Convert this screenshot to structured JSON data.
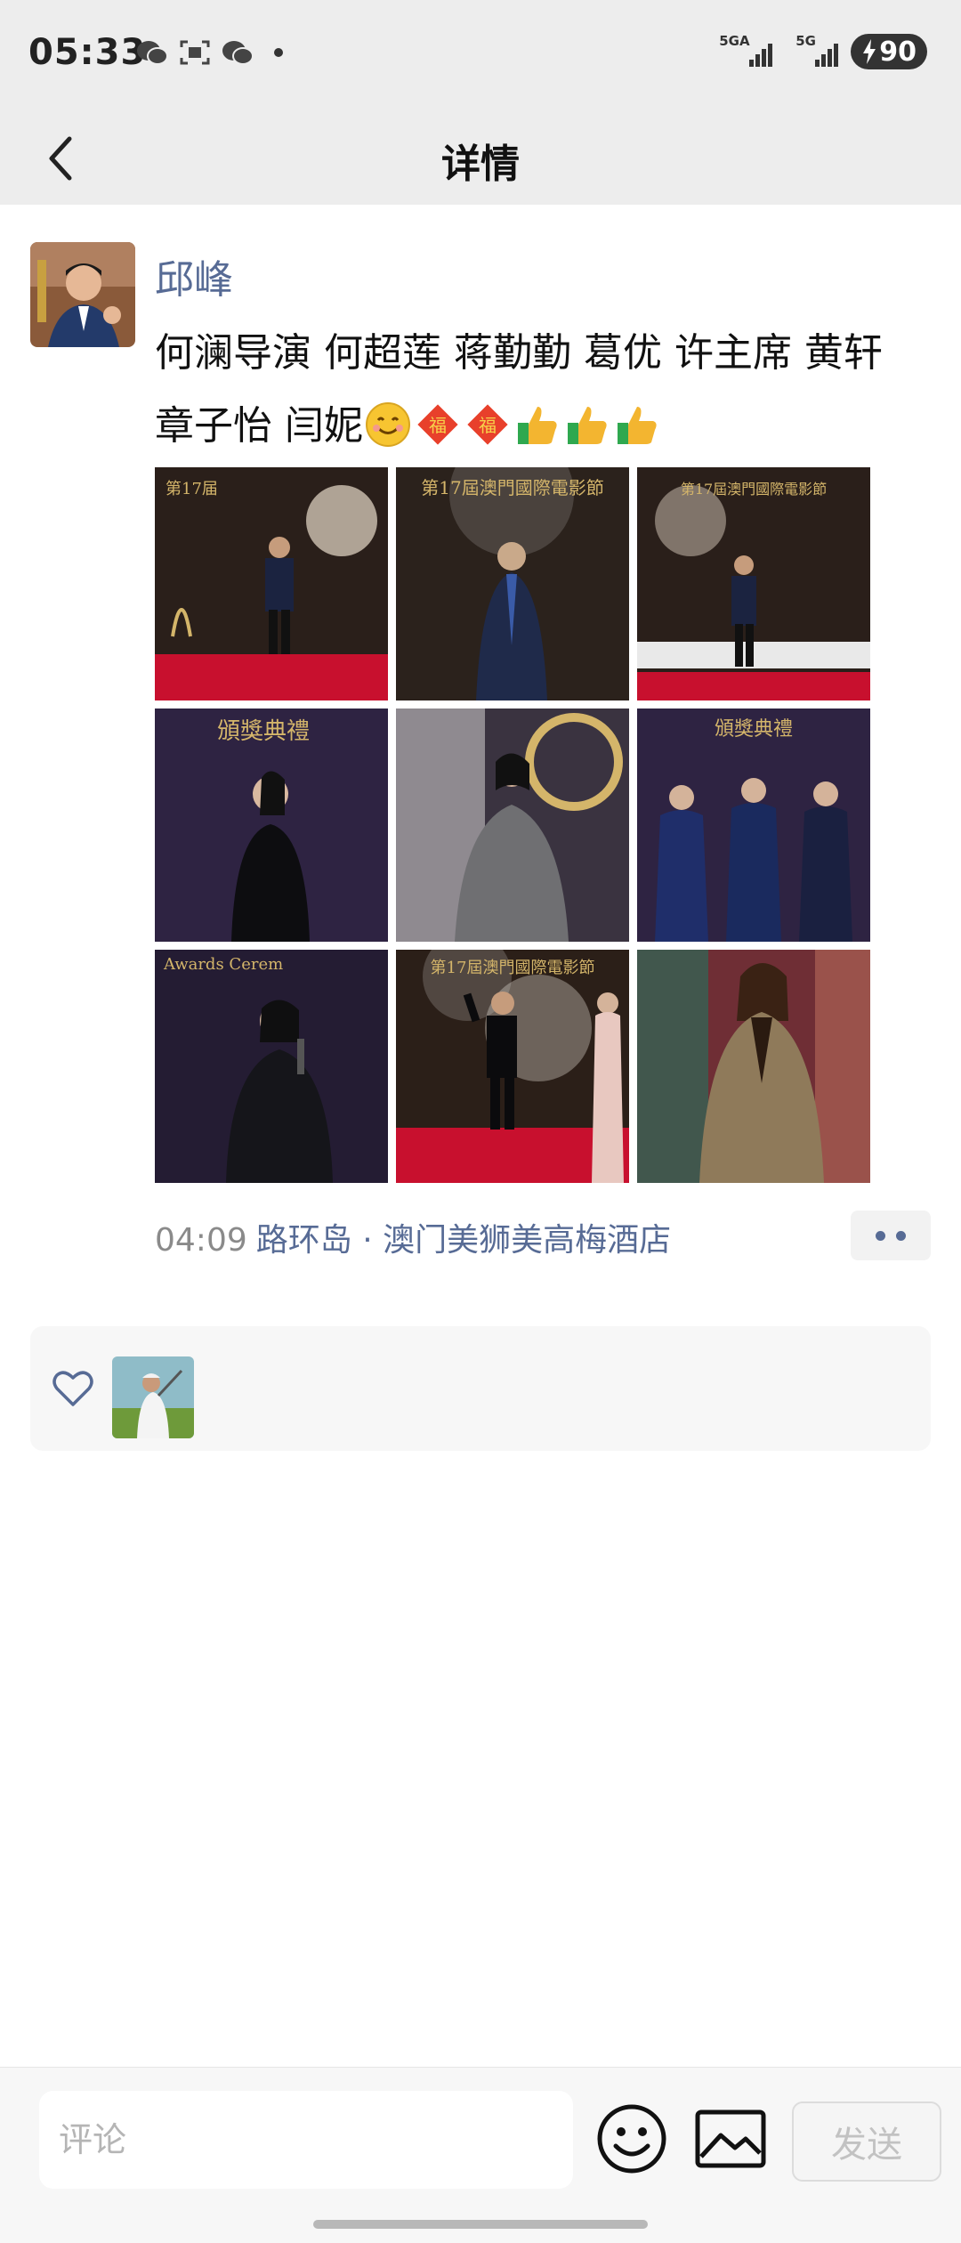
{
  "status_bar": {
    "time": "05:33",
    "network_1": "5GA",
    "network_2": "5G",
    "battery": "90"
  },
  "nav": {
    "title": "详情"
  },
  "post": {
    "author": "邱峰",
    "text_line1": "何澜导演 何超莲 蒋勤勤 葛优 许主席 黄轩",
    "text_line2": "章子怡 闫妮",
    "emojis": [
      "smile-emoji",
      "fu-emoji",
      "fu-emoji",
      "thumbs-up-emoji",
      "thumbs-up-emoji",
      "thumbs-up-emoji"
    ],
    "photos": [
      {
        "caption": "第17届",
        "scene": "red-carpet-stage"
      },
      {
        "caption": "第17屆澳門國際電影節",
        "scene": "backdrop-dark"
      },
      {
        "caption": "第17屆澳門國際電影節",
        "scene": "red-carpet-stage"
      },
      {
        "caption": "頒獎典禮",
        "scene": "purple-backdrop"
      },
      {
        "caption": "",
        "scene": "gold-wreath"
      },
      {
        "caption": "頒獎典禮",
        "scene": "group-purple"
      },
      {
        "caption": "Awards Cerem",
        "scene": "purple-backdrop"
      },
      {
        "caption": "第17屆澳門國際電影節",
        "scene": "red-carpet-stage"
      },
      {
        "caption": "",
        "scene": "colorful"
      }
    ],
    "time": "04:09",
    "location": "路环岛 · 澳门美狮美高梅酒店"
  },
  "comment_bar": {
    "placeholder": "评论",
    "send_label": "发送"
  },
  "colors": {
    "link": "#576b95",
    "header_bg": "#ededed",
    "red_carpet": "#c8102e"
  }
}
